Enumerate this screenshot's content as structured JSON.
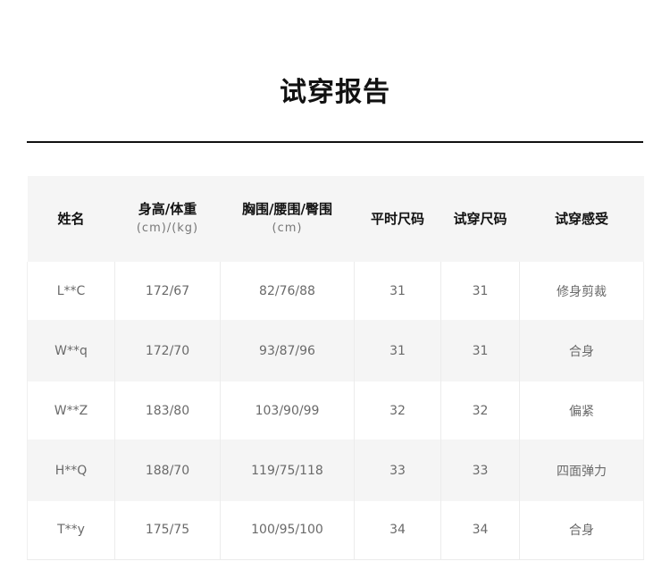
{
  "title": "试穿报告",
  "headers": [
    {
      "label": "姓名",
      "sub": ""
    },
    {
      "label": "身高/体重",
      "sub": "(cm)/(kg)"
    },
    {
      "label": "胸围/腰围/臀围",
      "sub": "(cm)"
    },
    {
      "label": "平时尺码",
      "sub": ""
    },
    {
      "label": "试穿尺码",
      "sub": ""
    },
    {
      "label": "试穿感受",
      "sub": ""
    }
  ],
  "rows": [
    {
      "name": "L**C",
      "height_weight": "172/67",
      "measurements": "82/76/88",
      "usual_size": "31",
      "tried_size": "31",
      "feeling": "修身剪裁"
    },
    {
      "name": "W**q",
      "height_weight": "172/70",
      "measurements": "93/87/96",
      "usual_size": "31",
      "tried_size": "31",
      "feeling": "合身"
    },
    {
      "name": "W**Z",
      "height_weight": "183/80",
      "measurements": "103/90/99",
      "usual_size": "32",
      "tried_size": "32",
      "feeling": "偏紧"
    },
    {
      "name": "H**Q",
      "height_weight": "188/70",
      "measurements": "119/75/118",
      "usual_size": "33",
      "tried_size": "33",
      "feeling": "四面弹力"
    },
    {
      "name": "T**y",
      "height_weight": "175/75",
      "measurements": "100/95/100",
      "usual_size": "34",
      "tried_size": "34",
      "feeling": "合身"
    }
  ]
}
